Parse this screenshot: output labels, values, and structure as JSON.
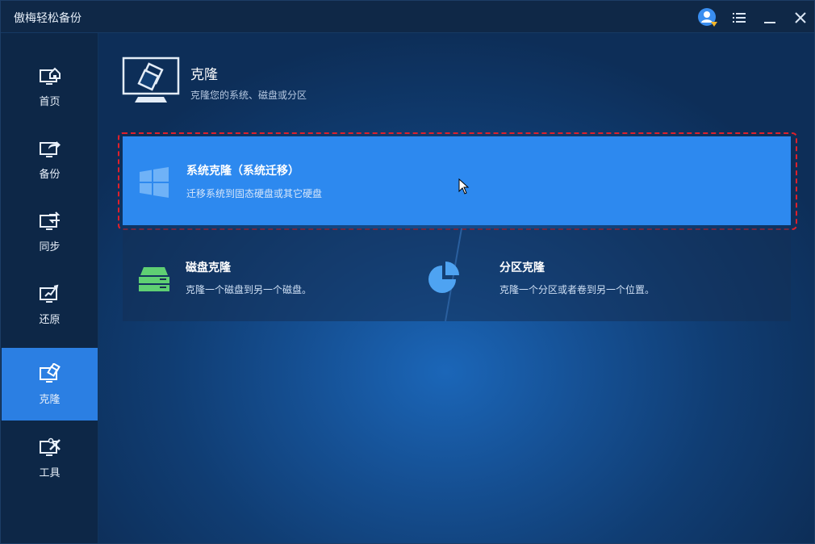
{
  "app": {
    "title": "傲梅轻松备份"
  },
  "titlebar": {
    "user_icon": "user-icon",
    "menu_icon": "menu-list-icon",
    "minimize_icon": "minimize-icon",
    "close_icon": "close-icon"
  },
  "sidebar": {
    "items": [
      {
        "label": "首页",
        "icon": "home-monitor-icon",
        "active": false
      },
      {
        "label": "备份",
        "icon": "backup-monitor-icon",
        "active": false
      },
      {
        "label": "同步",
        "icon": "sync-monitor-icon",
        "active": false
      },
      {
        "label": "还原",
        "icon": "restore-monitor-icon",
        "active": false
      },
      {
        "label": "克隆",
        "icon": "clone-monitor-icon",
        "active": true
      },
      {
        "label": "工具",
        "icon": "tools-monitor-icon",
        "active": false
      }
    ]
  },
  "main": {
    "title": "克隆",
    "description": "克隆您的系统、磁盘或分区",
    "cards": {
      "system": {
        "title": "系统克隆（系统迁移）",
        "description": "迁移系统到固态硬盘或其它硬盘",
        "icon": "windows-icon"
      },
      "disk": {
        "title": "磁盘克隆",
        "description": "克隆一个磁盘到另一个磁盘。",
        "icon": "disk-clone-icon"
      },
      "partition": {
        "title": "分区克隆",
        "description": "克隆一个分区或者卷到另一个位置。",
        "icon": "partition-pie-icon"
      }
    }
  },
  "colors": {
    "accent": "#2d89ef",
    "sidebar_active": "#2b7fe3",
    "highlight_ring": "#e0202a",
    "disk_green": "#5fcf73"
  }
}
